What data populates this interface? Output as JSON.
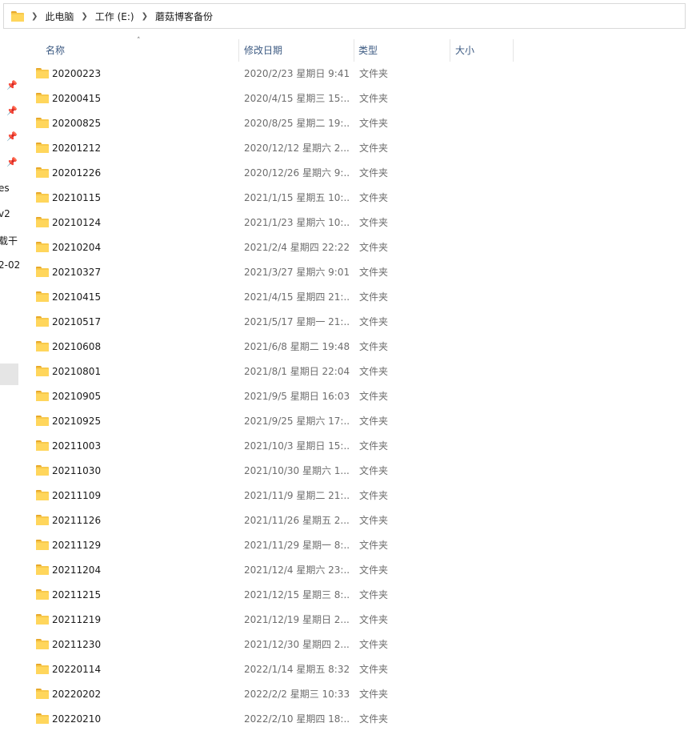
{
  "breadcrumb": [
    "此电脑",
    "工作 (E:)",
    "蘑菇博客备份"
  ],
  "columns": {
    "name": "名称",
    "date": "修改日期",
    "type": "类型",
    "size": "大小"
  },
  "nav_fragments": [
    "es",
    "v2",
    "载干",
    "2-02-"
  ],
  "folder_type": "文件夹",
  "files": [
    {
      "name": "20200223",
      "date": "2020/2/23 星期日 9:41",
      "type": "文件夹"
    },
    {
      "name": "20200415",
      "date": "2020/4/15 星期三 15:...",
      "type": "文件夹"
    },
    {
      "name": "20200825",
      "date": "2020/8/25 星期二 19:...",
      "type": "文件夹"
    },
    {
      "name": "20201212",
      "date": "2020/12/12 星期六 2...",
      "type": "文件夹"
    },
    {
      "name": "20201226",
      "date": "2020/12/26 星期六 9:...",
      "type": "文件夹"
    },
    {
      "name": "20210115",
      "date": "2021/1/15 星期五 10:...",
      "type": "文件夹"
    },
    {
      "name": "20210124",
      "date": "2021/1/23 星期六 10:...",
      "type": "文件夹"
    },
    {
      "name": "20210204",
      "date": "2021/2/4 星期四 22:22",
      "type": "文件夹"
    },
    {
      "name": "20210327",
      "date": "2021/3/27 星期六 9:01",
      "type": "文件夹"
    },
    {
      "name": "20210415",
      "date": "2021/4/15 星期四 21:...",
      "type": "文件夹"
    },
    {
      "name": "20210517",
      "date": "2021/5/17 星期一 21:...",
      "type": "文件夹"
    },
    {
      "name": "20210608",
      "date": "2021/6/8 星期二 19:48",
      "type": "文件夹"
    },
    {
      "name": "20210801",
      "date": "2021/8/1 星期日 22:04",
      "type": "文件夹"
    },
    {
      "name": "20210905",
      "date": "2021/9/5 星期日 16:03",
      "type": "文件夹"
    },
    {
      "name": "20210925",
      "date": "2021/9/25 星期六 17:...",
      "type": "文件夹"
    },
    {
      "name": "20211003",
      "date": "2021/10/3 星期日 15:...",
      "type": "文件夹"
    },
    {
      "name": "20211030",
      "date": "2021/10/30 星期六 1...",
      "type": "文件夹"
    },
    {
      "name": "20211109",
      "date": "2021/11/9 星期二 21:...",
      "type": "文件夹"
    },
    {
      "name": "20211126",
      "date": "2021/11/26 星期五 2...",
      "type": "文件夹"
    },
    {
      "name": "20211129",
      "date": "2021/11/29 星期一 8:...",
      "type": "文件夹"
    },
    {
      "name": "20211204",
      "date": "2021/12/4 星期六 23:...",
      "type": "文件夹"
    },
    {
      "name": "20211215",
      "date": "2021/12/15 星期三 8:...",
      "type": "文件夹"
    },
    {
      "name": "20211219",
      "date": "2021/12/19 星期日 2...",
      "type": "文件夹"
    },
    {
      "name": "20211230",
      "date": "2021/12/30 星期四 2...",
      "type": "文件夹"
    },
    {
      "name": "20220114",
      "date": "2022/1/14 星期五 8:32",
      "type": "文件夹"
    },
    {
      "name": "20220202",
      "date": "2022/2/2 星期三 10:33",
      "type": "文件夹"
    },
    {
      "name": "20220210",
      "date": "2022/2/10 星期四 18:...",
      "type": "文件夹"
    }
  ],
  "icons": {
    "folder": "folder-icon",
    "chevron": "chevron-right-icon",
    "pin": "pin-icon",
    "sort": "sort-up-icon"
  }
}
